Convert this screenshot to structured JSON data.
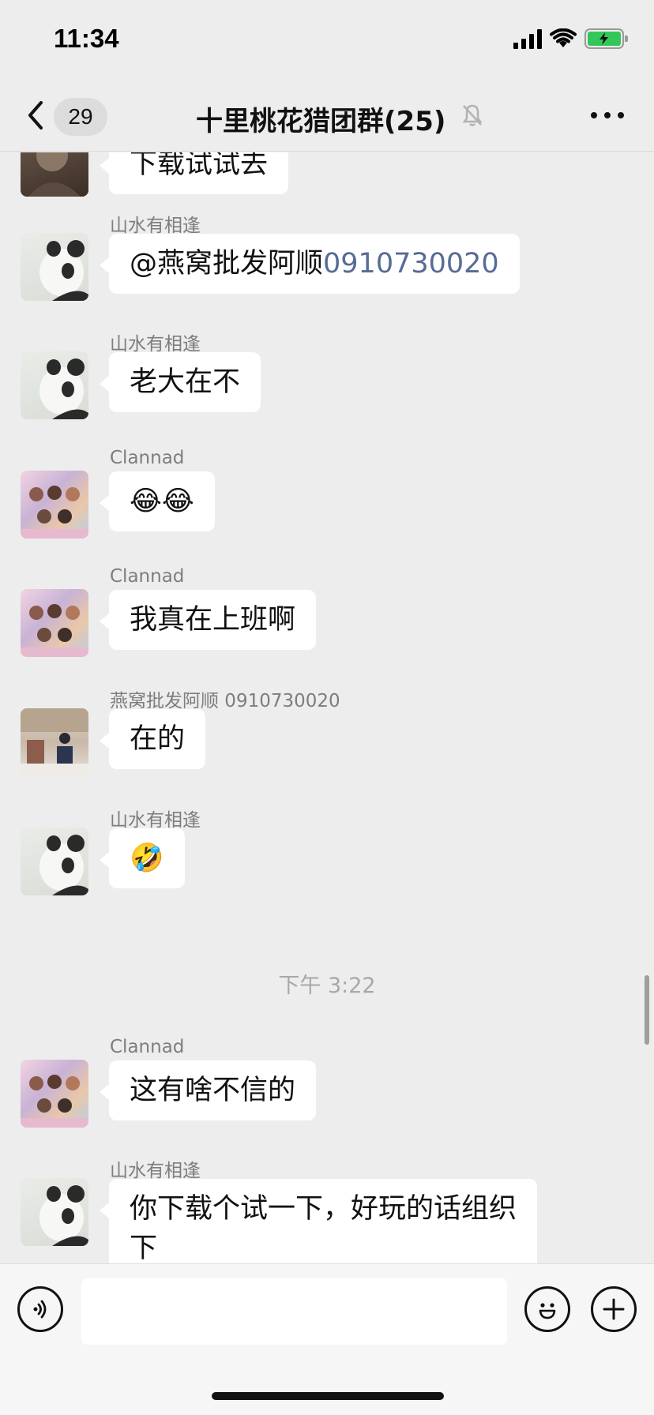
{
  "status_bar": {
    "time": "11:34",
    "battery_color": "#33c759"
  },
  "nav": {
    "back_icon": "chevron-left-icon",
    "unread_count": "29",
    "title": "十里桃花猎团群(25)",
    "mute_icon": "bell-slash-icon",
    "more_icon": "more-dots-icon"
  },
  "messages": [
    {
      "sender": "",
      "text": "下载试试去",
      "avatar": "stone-statue-avatar"
    },
    {
      "sender": "山水有相逢",
      "mention": "@燕窝批发阿顺",
      "mention_number": "0910730020",
      "avatar": "panda-avatar"
    },
    {
      "sender": "山水有相逢",
      "text": "老大在不",
      "avatar": "panda-avatar"
    },
    {
      "sender": "Clannad",
      "text": "😂😂",
      "avatar": "anime-avatar"
    },
    {
      "sender": "Clannad",
      "text": "我真在上班啊",
      "avatar": "anime-avatar"
    },
    {
      "sender": "燕窝批发阿顺 0910730020",
      "text": "在的",
      "avatar": "photo-avatar"
    },
    {
      "sender": "山水有相逢",
      "text": "🤣",
      "avatar": "panda-avatar"
    },
    {
      "sender": "Clannad",
      "text": "这有啥不信的",
      "avatar": "anime-avatar"
    },
    {
      "sender": "山水有相逢",
      "text_line1": "你下载个试一下，好玩的话组织",
      "text_line2": "下",
      "avatar": "panda-avatar"
    }
  ],
  "time_divider": "下午 3:22",
  "input_bar": {
    "voice_icon": "voice-icon",
    "emoji_icon": "emoji-icon",
    "plus_icon": "plus-icon",
    "input_value": ""
  },
  "colors": {
    "background": "#ededed",
    "bubble": "#ffffff",
    "link": "#576b95"
  }
}
